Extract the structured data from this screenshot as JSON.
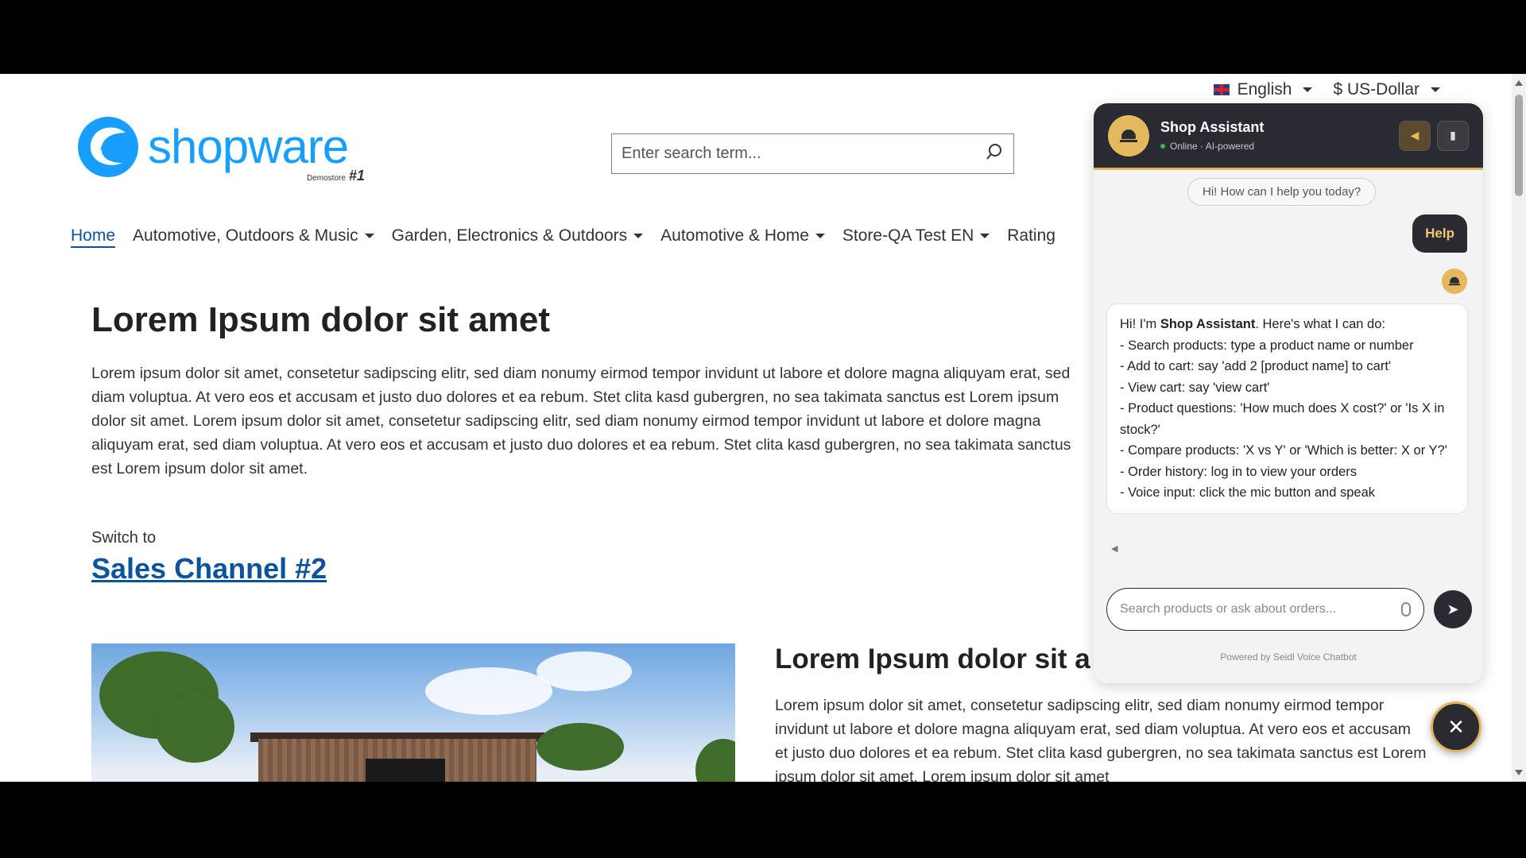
{
  "topbar": {
    "language": "English",
    "currency": "$ US-Dollar"
  },
  "logo": {
    "word": "shopware",
    "sub": "Demostore",
    "sub_num": "#1"
  },
  "search": {
    "placeholder": "Enter search term..."
  },
  "nav": {
    "items": [
      {
        "label": "Home"
      },
      {
        "label": "Automotive, Outdoors & Music"
      },
      {
        "label": "Garden, Electronics & Outdoors"
      },
      {
        "label": "Automotive & Home"
      },
      {
        "label": "Store-QA Test EN"
      },
      {
        "label": "Rating"
      }
    ]
  },
  "content": {
    "title": "Lorem Ipsum dolor sit amet",
    "paragraph": "Lorem ipsum dolor sit amet, consetetur sadipscing elitr, sed diam nonumy eirmod tempor invidunt ut labore et dolore magna aliquyam erat, sed diam voluptua. At vero eos et accusam et justo duo dolores et ea rebum. Stet clita kasd gubergren, no sea takimata sanctus est Lorem ipsum dolor sit amet. Lorem ipsum dolor sit amet, consetetur sadipscing elitr, sed diam nonumy eirmod tempor invidunt ut labore et dolore magna aliquyam erat, sed diam voluptua. At vero eos et accusam et justo duo dolores et ea rebum. Stet clita kasd gubergren, no sea takimata sanctus est Lorem ipsum dolor sit amet.",
    "switch_label": "Switch to",
    "switch_link": "Sales Channel #2",
    "title2": "Lorem Ipsum dolor sit a",
    "paragraph2": "Lorem ipsum dolor sit amet, consetetur sadipscing elitr, sed diam nonumy eirmod tempor invidunt ut labore et dolore magna aliquyam erat, sed diam voluptua. At vero eos et accusam et justo duo dolores et ea rebum. Stet clita kasd gubergren, no sea takimata sanctus est Lorem ipsum dolor sit amet. Lorem ipsum dolor sit amet"
  },
  "chat": {
    "title": "Shop Assistant",
    "status": "Online · AI-powered",
    "greeting": "Hi! How can I help you today?",
    "user_message": "Help",
    "bot_intro_pre": "Hi! I'm ",
    "bot_intro_name": "Shop Assistant",
    "bot_intro_post": ". Here's what I can do:",
    "bot_lines": [
      "- Search products: type a product name or number",
      "- Add to cart: say 'add 2 [product name] to cart'",
      "- View cart: say 'view cart'",
      "- Product questions: 'How much does X cost?' or 'Is X in stock?'",
      "- Compare products: 'X vs Y' or 'Which is better: X or Y?'",
      "- Order history: log in to view your orders",
      "- Voice input: click the mic button and speak"
    ],
    "input_placeholder": "Search products or ask about orders...",
    "powered_by": "Powered by Seidl Voice Chatbot"
  },
  "colors": {
    "brand": "#189eff",
    "link": "#0b539b",
    "chat_dark": "#2a2a33",
    "chat_accent": "#e5b85e"
  }
}
